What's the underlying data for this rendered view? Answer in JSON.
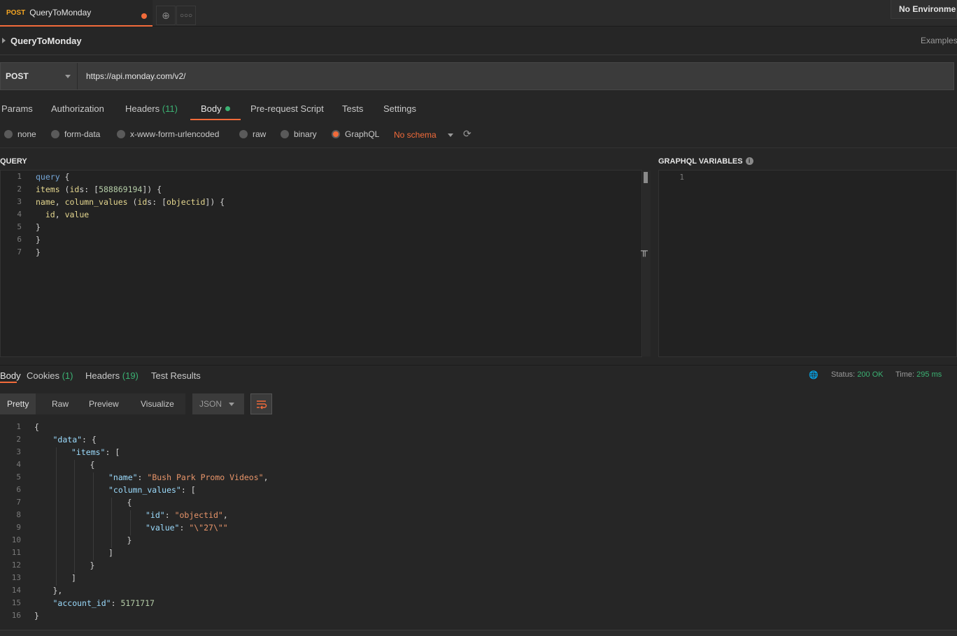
{
  "tab": {
    "method": "POST",
    "name": "QueryToMonday"
  },
  "environment": "No Environment",
  "request": {
    "title": "QueryToMonday",
    "examples_label": "Examples",
    "method": "POST",
    "url": "https://api.monday.com/v2/"
  },
  "request_tabs": {
    "params": "Params",
    "authorization": "Authorization",
    "headers": "Headers",
    "headers_count": "(11)",
    "body": "Body",
    "prerequest": "Pre-request Script",
    "tests": "Tests",
    "settings": "Settings"
  },
  "body_types": {
    "none": "none",
    "form_data": "form-data",
    "urlencoded": "x-www-form-urlencoded",
    "raw": "raw",
    "binary": "binary",
    "graphql": "GraphQL",
    "schema": "No schema"
  },
  "query_label": "QUERY",
  "variables_label": "GRAPHQL VARIABLES",
  "query_lines": [
    {
      "n": "1",
      "text": "query {"
    },
    {
      "n": "2",
      "text": "items (ids: [588869194]) {"
    },
    {
      "n": "3",
      "text": "name, column_values (ids: [objectid]) {"
    },
    {
      "n": "4",
      "text": "  id, value"
    },
    {
      "n": "5",
      "text": "}"
    },
    {
      "n": "6",
      "text": "}"
    },
    {
      "n": "7",
      "text": "}"
    }
  ],
  "variables_line": "1",
  "response_tabs": {
    "body": "Body",
    "cookies": "Cookies",
    "cookies_count": "(1)",
    "headers": "Headers",
    "headers_count": "(19)",
    "test_results": "Test Results"
  },
  "status": {
    "status_label": "Status:",
    "status_value": "200 OK",
    "time_label": "Time:",
    "time_value": "295 ms"
  },
  "view_tabs": {
    "pretty": "Pretty",
    "raw": "Raw",
    "preview": "Preview",
    "visualize": "Visualize"
  },
  "format": "JSON",
  "response_lines": [
    {
      "n": "1",
      "indent": 0,
      "parts": [
        [
          "p",
          "{"
        ]
      ]
    },
    {
      "n": "2",
      "indent": 1,
      "parts": [
        [
          "k",
          "\"data\""
        ],
        [
          "p",
          ": {"
        ]
      ]
    },
    {
      "n": "3",
      "indent": 2,
      "parts": [
        [
          "k",
          "\"items\""
        ],
        [
          "p",
          ": ["
        ]
      ]
    },
    {
      "n": "4",
      "indent": 3,
      "parts": [
        [
          "p",
          "{"
        ]
      ]
    },
    {
      "n": "5",
      "indent": 4,
      "parts": [
        [
          "k",
          "\"name\""
        ],
        [
          "p",
          ": "
        ],
        [
          "s",
          "\"Bush Park Promo Videos\""
        ],
        [
          "p",
          ","
        ]
      ]
    },
    {
      "n": "6",
      "indent": 4,
      "parts": [
        [
          "k",
          "\"column_values\""
        ],
        [
          "p",
          ": ["
        ]
      ]
    },
    {
      "n": "7",
      "indent": 5,
      "parts": [
        [
          "p",
          "{"
        ]
      ]
    },
    {
      "n": "8",
      "indent": 6,
      "parts": [
        [
          "k",
          "\"id\""
        ],
        [
          "p",
          ": "
        ],
        [
          "s",
          "\"objectid\""
        ],
        [
          "p",
          ","
        ]
      ]
    },
    {
      "n": "9",
      "indent": 6,
      "parts": [
        [
          "k",
          "\"value\""
        ],
        [
          "p",
          ": "
        ],
        [
          "s",
          "\"\\\"27\\\"\""
        ]
      ]
    },
    {
      "n": "10",
      "indent": 5,
      "parts": [
        [
          "p",
          "}"
        ]
      ]
    },
    {
      "n": "11",
      "indent": 4,
      "parts": [
        [
          "p",
          "]"
        ]
      ]
    },
    {
      "n": "12",
      "indent": 3,
      "parts": [
        [
          "p",
          "}"
        ]
      ]
    },
    {
      "n": "13",
      "indent": 2,
      "parts": [
        [
          "p",
          "]"
        ]
      ]
    },
    {
      "n": "14",
      "indent": 1,
      "parts": [
        [
          "p",
          "},"
        ]
      ]
    },
    {
      "n": "15",
      "indent": 1,
      "parts": [
        [
          "k",
          "\"account_id\""
        ],
        [
          "p",
          ": "
        ],
        [
          "num",
          "5171717"
        ]
      ]
    },
    {
      "n": "16",
      "indent": 0,
      "parts": [
        [
          "p",
          "}"
        ]
      ]
    }
  ]
}
